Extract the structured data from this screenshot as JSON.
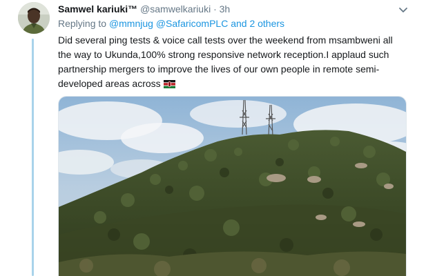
{
  "tweet": {
    "author_name": "Samwel kariuki™",
    "handle": "@samwelkariuki",
    "separator": "·",
    "time": "3h",
    "reply_prefix": "Replying to",
    "reply_to_1": "@mmnjug",
    "reply_to_2": "@SafaricomPLC",
    "reply_suffix": "and 2 others",
    "text": "Did several ping tests & voice call tests over the weekend from msambweni all the way to Ukunda,100% strong responsive network reception.I applaud such partnership mergers to improve the lives of our own people in remote semi-developed areas across",
    "emoji": "kenya-flag-icon"
  },
  "colors": {
    "link": "#1b95e0",
    "muted": "#657786",
    "thread_line": "#a8d3ea"
  }
}
